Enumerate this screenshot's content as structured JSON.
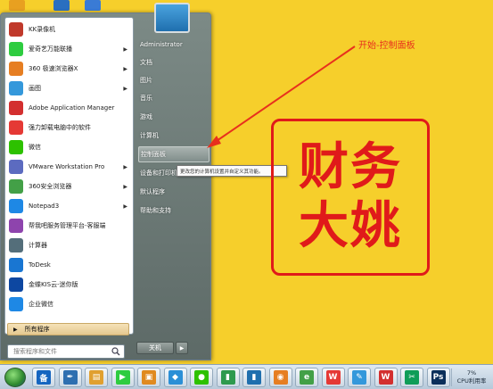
{
  "annotation": {
    "text": "开始-控制面板"
  },
  "stamp": {
    "line1": "财务",
    "line2": "大姚",
    "color": "#e01a1a"
  },
  "start_menu": {
    "programs": [
      {
        "label": "KK录像机",
        "icon": "kk-recorder-icon",
        "color": "#c0392b",
        "has_arrow": false
      },
      {
        "label": "爱奇艺万能联播",
        "icon": "iqiyi-icon",
        "color": "#2ecc40",
        "has_arrow": true
      },
      {
        "label": "360 极速浏览器X",
        "icon": "360-speed-browser-icon",
        "color": "#e67e22",
        "has_arrow": true
      },
      {
        "label": "画图",
        "icon": "paint-icon",
        "color": "#3498db",
        "has_arrow": true
      },
      {
        "label": "Adobe Application Manager",
        "icon": "adobe-icon",
        "color": "#d32f2f",
        "has_arrow": false
      },
      {
        "label": "强力卸载电脑中的软件",
        "icon": "uninstall-icon",
        "color": "#e53935",
        "has_arrow": false
      },
      {
        "label": "微信",
        "icon": "wechat-icon",
        "color": "#2dc100",
        "has_arrow": false
      },
      {
        "label": "VMware Workstation Pro",
        "icon": "vmware-icon",
        "color": "#5c6bc0",
        "has_arrow": true
      },
      {
        "label": "360安全浏览器",
        "icon": "360-safe-browser-icon",
        "color": "#43a047",
        "has_arrow": true
      },
      {
        "label": "Notepad3",
        "icon": "notepad3-icon",
        "color": "#1e88e5",
        "has_arrow": true
      },
      {
        "label": "帮我吧服务管理平台-客服端",
        "icon": "helpme-icon",
        "color": "#8e44ad",
        "has_arrow": false
      },
      {
        "label": "计算器",
        "icon": "calculator-icon",
        "color": "#546e7a",
        "has_arrow": false
      },
      {
        "label": "ToDesk",
        "icon": "todesk-icon",
        "color": "#1976d2",
        "has_arrow": false
      },
      {
        "label": "金蝶KIS云-迷你版",
        "icon": "kingdee-icon",
        "color": "#0d47a1",
        "has_arrow": false
      },
      {
        "label": "企业微信",
        "icon": "wecom-icon",
        "color": "#1e88e5",
        "has_arrow": false
      }
    ],
    "all_programs_label": "所有程序",
    "search_placeholder": "搜索程序和文件",
    "right_items": [
      {
        "label": "Administrator",
        "hover": false
      },
      {
        "label": "文档",
        "hover": false
      },
      {
        "label": "图片",
        "hover": false
      },
      {
        "label": "音乐",
        "hover": false
      },
      {
        "label": "游戏",
        "hover": false
      },
      {
        "label": "计算机",
        "hover": false
      },
      {
        "label": "控制面板",
        "hover": true
      },
      {
        "label": "设备和打印机",
        "hover": false
      },
      {
        "label": "默认程序",
        "hover": false
      },
      {
        "label": "帮助和支持",
        "hover": false
      }
    ],
    "tooltip": "更改您的计算机设置并自定义其功能。",
    "shutdown_label": "关机"
  },
  "taskbar": {
    "apps": [
      {
        "name": "baidu-input-icon",
        "glyph": "备",
        "color": "#1565c0"
      },
      {
        "name": "pen-app-icon",
        "glyph": "✒",
        "color": "#2e6fb0"
      },
      {
        "name": "explorer-icon",
        "glyph": "▤",
        "color": "#e0a030"
      },
      {
        "name": "iqiyi-taskbar-icon",
        "glyph": "▶",
        "color": "#2ecc40"
      },
      {
        "name": "window-app-icon",
        "glyph": "▣",
        "color": "#e08a20"
      },
      {
        "name": "diamond-app-icon",
        "glyph": "◆",
        "color": "#2b8fd6"
      },
      {
        "name": "wechat-taskbar-icon",
        "glyph": "●",
        "color": "#2dc100"
      },
      {
        "name": "green-app-icon",
        "glyph": "▮",
        "color": "#2e9a4e"
      },
      {
        "name": "blue-app-icon",
        "glyph": "▮",
        "color": "#1f6fae"
      },
      {
        "name": "360x-taskbar-icon",
        "glyph": "◉",
        "color": "#e67e22"
      },
      {
        "name": "360-safe-taskbar-icon",
        "glyph": "e",
        "color": "#43a047"
      },
      {
        "name": "wps-icon",
        "glyph": "W",
        "color": "#e53935"
      },
      {
        "name": "paint-taskbar-icon",
        "glyph": "✎",
        "color": "#3498db"
      },
      {
        "name": "wps-writer-icon",
        "glyph": "W",
        "color": "#d32f2f"
      },
      {
        "name": "snipping-icon",
        "glyph": "✂",
        "color": "#0f9d58"
      },
      {
        "name": "photoshop-icon",
        "glyph": "Ps",
        "color": "#0b2f5a"
      }
    ],
    "cpu_percent": "7%",
    "cpu_label": "CPU利用率"
  }
}
